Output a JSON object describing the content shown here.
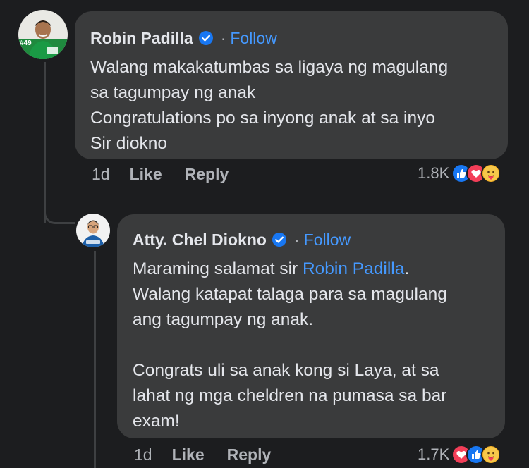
{
  "comment": {
    "author": "Robin Padilla",
    "follow_label": "Follow",
    "avatar_badge": "#49",
    "lines": [
      "Walang makakatumbas sa ligaya ng magulang",
      "sa tagumpay ng anak",
      "Congratulations po sa inyong anak at sa inyo",
      "Sir diokno"
    ],
    "time": "1d",
    "like_label": "Like",
    "reply_label": "Reply",
    "reaction_count": "1.8K",
    "reactions": [
      "like-icon",
      "love-icon",
      "care-icon"
    ]
  },
  "reply": {
    "author": "Atty. Chel Diokno",
    "follow_label": "Follow",
    "line1_prefix": "Maraming salamat sir ",
    "mention": "Robin Padilla",
    "line1_suffix": ".",
    "lines": [
      "Walang katapat talaga para sa magulang",
      "ang tagumpay ng anak."
    ],
    "lines2": [
      "Congrats uli sa anak kong si Laya, at sa",
      "lahat ng mga cheldren na pumasa sa bar",
      "exam!"
    ],
    "time": "1d",
    "like_label": "Like",
    "reply_label": "Reply",
    "reaction_count": "1.7K",
    "reactions": [
      "love-icon",
      "like-icon",
      "care-icon"
    ]
  },
  "colors": {
    "background": "#1c1d1f",
    "bubble": "#3a3b3c",
    "link": "#4599ff",
    "secondary_text": "#b0b3b8",
    "like": "#1877f2",
    "love": "#f33e58",
    "care": "#f7b125"
  }
}
